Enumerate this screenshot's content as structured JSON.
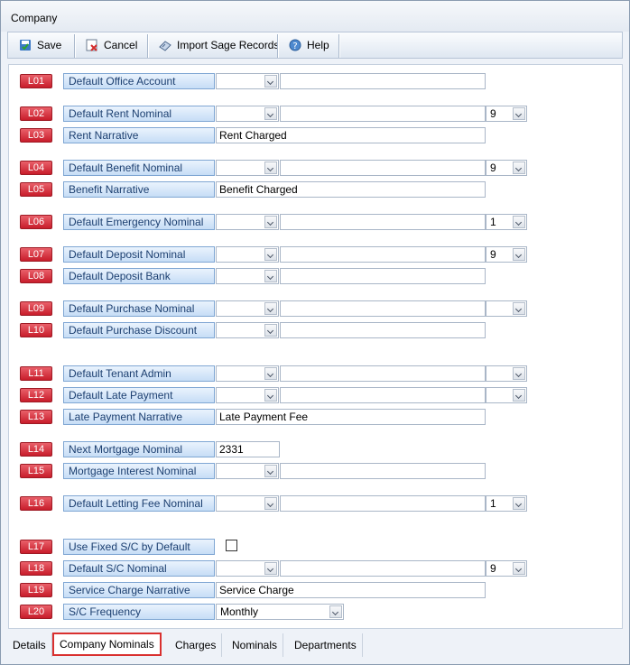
{
  "window": {
    "title": "Company"
  },
  "toolbar": {
    "save": "Save",
    "cancel": "Cancel",
    "import": "Import Sage Records",
    "help": "Help"
  },
  "rows": {
    "L01": {
      "code": "L01",
      "label": "Default Office Account"
    },
    "L02": {
      "code": "L02",
      "label": "Default Rent Nominal",
      "extra": "9"
    },
    "L03": {
      "code": "L03",
      "label": "Rent Narrative",
      "value": "Rent Charged"
    },
    "L04": {
      "code": "L04",
      "label": "Default Benefit Nominal",
      "extra": "9"
    },
    "L05": {
      "code": "L05",
      "label": "Benefit Narrative",
      "value": "Benefit Charged"
    },
    "L06": {
      "code": "L06",
      "label": "Default Emergency Nominal",
      "extra": "1"
    },
    "L07": {
      "code": "L07",
      "label": "Default Deposit Nominal",
      "extra": "9"
    },
    "L08": {
      "code": "L08",
      "label": "Default Deposit Bank"
    },
    "L09": {
      "code": "L09",
      "label": "Default Purchase Nominal",
      "extra": ""
    },
    "L10": {
      "code": "L10",
      "label": "Default Purchase Discount"
    },
    "L11": {
      "code": "L11",
      "label": "Default Tenant Admin",
      "extra": ""
    },
    "L12": {
      "code": "L12",
      "label": "Default Late Payment",
      "extra": ""
    },
    "L13": {
      "code": "L13",
      "label": "Late Payment Narrative",
      "value": "Late Payment Fee"
    },
    "L14": {
      "code": "L14",
      "label": "Next Mortgage Nominal",
      "value": "2331"
    },
    "L15": {
      "code": "L15",
      "label": "Mortgage Interest Nominal"
    },
    "L16": {
      "code": "L16",
      "label": "Default Letting Fee Nominal",
      "extra": "1"
    },
    "L17": {
      "code": "L17",
      "label": "Use Fixed S/C by Default"
    },
    "L18": {
      "code": "L18",
      "label": "Default S/C Nominal",
      "extra": "9"
    },
    "L19": {
      "code": "L19",
      "label": "Service Charge Narrative",
      "value": "Service Charge"
    },
    "L20": {
      "code": "L20",
      "label": "S/C Frequency",
      "value": "Monthly"
    }
  },
  "tabs": {
    "details": "Details",
    "company_nominals": "Company Nominals",
    "charges": "Charges",
    "nominals": "Nominals",
    "departments": "Departments"
  }
}
